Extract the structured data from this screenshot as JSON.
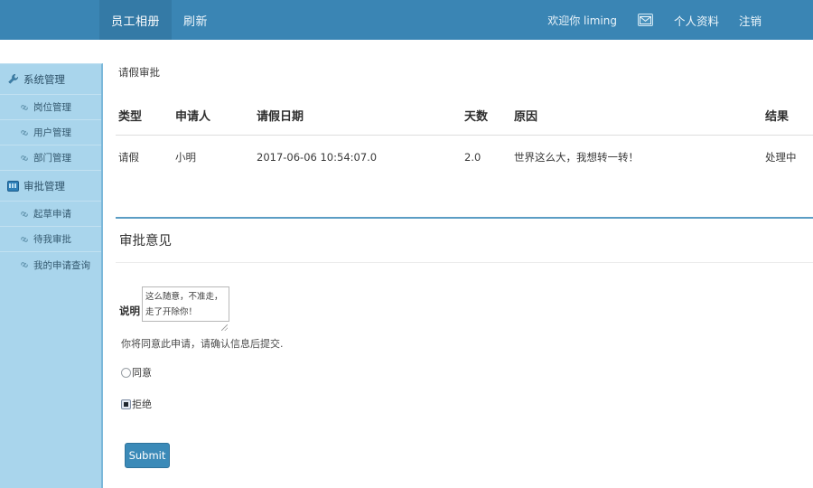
{
  "navbar": {
    "items": [
      {
        "label": "员工相册",
        "active": true
      },
      {
        "label": "刷新",
        "active": false
      }
    ],
    "welcome": "欢迎你  liming",
    "mail_icon": "envelope-icon",
    "profile_link": "个人资料",
    "logout_link": "注销",
    "bg_color": "#3a85b4",
    "active_bg_color": "#347aa6"
  },
  "sidebar": {
    "bg_color": "#a9d5ec",
    "groups": [
      {
        "label": "系统管理",
        "icon": "wrench-icon",
        "items": [
          {
            "label": "岗位管理",
            "icon": "link-icon"
          },
          {
            "label": "用户管理",
            "icon": "link-icon"
          },
          {
            "label": "部门管理",
            "icon": "link-icon"
          }
        ]
      },
      {
        "label": "审批管理",
        "icon": "approval-badge-icon",
        "items": [
          {
            "label": "起草申请",
            "icon": "link-icon"
          },
          {
            "label": "待我审批",
            "icon": "link-icon"
          },
          {
            "label": "我的申请查询",
            "icon": "link-icon"
          }
        ]
      }
    ]
  },
  "main": {
    "page_title": "请假审批",
    "table": {
      "headers": [
        "类型",
        "申请人",
        "请假日期",
        "天数",
        "原因",
        "结果"
      ],
      "rows": [
        {
          "type": "请假",
          "person": "小明",
          "date": "2017-06-06 10:54:07.0",
          "days": "2.0",
          "reason": "世界这么大，我想转一转！",
          "result": "处理中"
        }
      ]
    },
    "divider_color": "#5b9dc4",
    "approval": {
      "heading": "审批意见",
      "comment_label": "说明",
      "comment_value": "这么随意，不准走，走了开除你！",
      "comment_placeholder": "",
      "note": "你将同意此申请，请确认信息后提交.",
      "options": [
        {
          "label": "同意",
          "checked": false
        },
        {
          "label": "拒绝",
          "checked": true
        }
      ],
      "submit_label": "Submit",
      "submit_color": "#3b8ab8"
    }
  }
}
